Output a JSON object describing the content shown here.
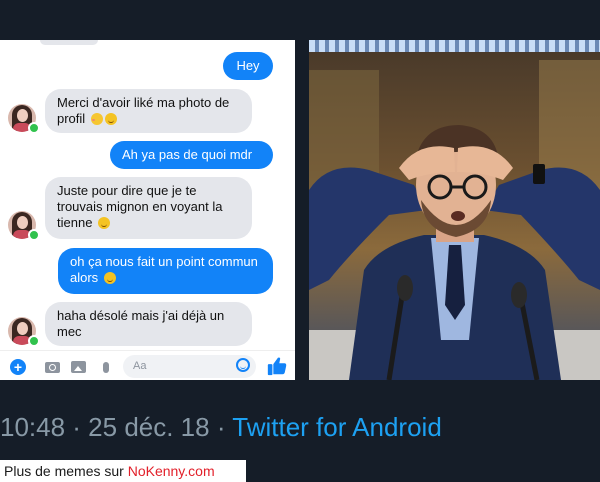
{
  "chat": {
    "messages": [
      {
        "from": "me",
        "text": "Hey"
      },
      {
        "from": "them",
        "text": "Merci d'avoir liké ma photo de profil"
      },
      {
        "from": "me",
        "text": "Ah ya pas de quoi mdr"
      },
      {
        "from": "them",
        "text": "Juste pour dire que je te trouvais mignon en voyant la tienne"
      },
      {
        "from": "me",
        "text": "oh ça nous fait un point commun alors"
      },
      {
        "from": "them",
        "text": "haha désolé mais j'ai déjà un mec"
      }
    ],
    "input_placeholder": "Aa",
    "colors": {
      "outgoing": "#1283f8",
      "incoming": "#e4e6eb",
      "online": "#31c24d"
    },
    "icons": [
      "plus-icon",
      "camera-icon",
      "gallery-icon",
      "mic-icon",
      "smiley-icon",
      "thumbs-up-icon"
    ]
  },
  "tweet": {
    "timestamp": "10:48 · 25 déc. 18 · ",
    "source": "Twitter for Android"
  },
  "credit": {
    "text": "Plus de memes sur ",
    "brand": "NoKenny.com"
  }
}
